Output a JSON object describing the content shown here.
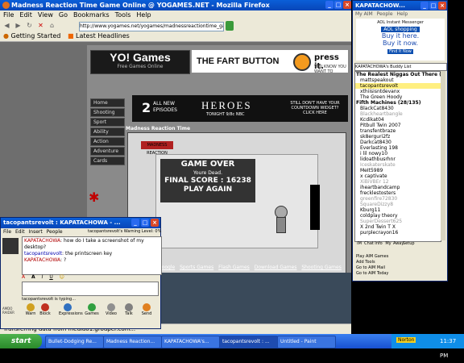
{
  "firefox": {
    "title": "Madness Reaction Time Game Online @ YOGAMES.NET - Mozilla Firefox",
    "menu": [
      "File",
      "Edit",
      "View",
      "Go",
      "Bookmarks",
      "Tools",
      "Help"
    ],
    "url": "http://www.yogames.net/yogames/madnessreactiontime_game.html",
    "bookmarks": [
      "Getting Started",
      "Latest Headlines"
    ],
    "status": "Transferring data from media01.grouper.com..."
  },
  "site": {
    "logo": "YO! Games",
    "logo_sub": "Free Games Online",
    "fart_ad": {
      "text": "THE FART BUTTON",
      "press": "press it.",
      "sub": "YOU KNOW YOU WANT TO"
    },
    "nav": [
      "Home",
      "Shooting",
      "Sport",
      "Ability",
      "Action",
      "Adventure",
      "Cards"
    ],
    "heroes_ad": {
      "number": "2",
      "line1": "ALL NEW",
      "line2": "EPISODES",
      "title": "HEROES",
      "tonight": "TONIGHT 9/8c NBC",
      "right": "STILL DON'T HAVE YOUR COUNTDOWN WIDGET? CLICK HERE"
    },
    "game_title": "Madness Reaction Time",
    "game": {
      "logo": "MADNESS REACTION",
      "over": "GAME OVER",
      "sub": "Youre Dead.",
      "score": "FINAL SCORE : 16238",
      "again": "PLAY AGAIN"
    },
    "google_links": [
      "Google",
      "Sports Games",
      "Flash Games",
      "Download Games",
      "Shooting Games"
    ]
  },
  "aim_buddylist": {
    "title": "KAPATACHOW...",
    "menu": [
      "My AIM",
      "People",
      "Help"
    ],
    "ad": {
      "brand": "AOL Instant Messenger",
      "shopping": "AOL shopping",
      "line1": "Buy it here.",
      "line2": "Buy it now.",
      "cta": "Find It Now"
    },
    "heading": "KAPATACHOWA's Buddy List",
    "rows": [
      {
        "text": "The Realest Niggas Out There (4/13)",
        "type": "group"
      },
      {
        "text": "mattspeakout",
        "type": "buddy"
      },
      {
        "text": "tacopantsrevolt",
        "type": "highlight"
      },
      {
        "text": "xthiisisntdevanx",
        "type": "buddy"
      },
      {
        "text": "The Green Hoody",
        "type": "buddy"
      },
      {
        "text": "Fifth Machines (28/135)",
        "type": "group"
      },
      {
        "text": "BlackCat8430",
        "type": "buddy"
      },
      {
        "text": "Blackheartbangle",
        "type": "idle"
      },
      {
        "text": "Kcdikat04",
        "type": "buddy"
      },
      {
        "text": "Pitbull Twin 2007",
        "type": "buddy"
      },
      {
        "text": "transfentbraze",
        "type": "buddy"
      },
      {
        "text": "sk8erguri2fz",
        "type": "buddy"
      },
      {
        "text": "Darkcat8430",
        "type": "buddy"
      },
      {
        "text": "Everlasting 198",
        "type": "buddy"
      },
      {
        "text": "i lil nowy10",
        "type": "buddy"
      },
      {
        "text": "lidoathbusrhnr",
        "type": "buddy"
      },
      {
        "text": "Iceskaterskate",
        "type": "idle"
      },
      {
        "text": "MeIt5989",
        "type": "buddy"
      },
      {
        "text": "x captivate",
        "type": "buddy"
      },
      {
        "text": "XiBiVBEr 12",
        "type": "idle"
      },
      {
        "text": "iheartbandcamp",
        "type": "buddy"
      },
      {
        "text": "frecklestosters",
        "type": "buddy"
      },
      {
        "text": "greenfire72830",
        "type": "idle"
      },
      {
        "text": "SquareDizzy8",
        "type": "idle"
      },
      {
        "text": "Kburg11",
        "type": "buddy"
      },
      {
        "text": "coldplay theory",
        "type": "buddy"
      },
      {
        "text": "SuperDessert625",
        "type": "idle"
      },
      {
        "text": "X 2nd Twin T X",
        "type": "buddy"
      },
      {
        "text": "purplecrayon16",
        "type": "buddy"
      }
    ],
    "toolbar": [
      "IM",
      "Chat",
      "Info",
      "My",
      "Away",
      "Setup"
    ],
    "links": [
      "Play AIM Games",
      "Add Tools",
      "Go to AIM Mail",
      "Go to AIM Today"
    ]
  },
  "im_window": {
    "title": "tacopantsrevolt : KAPATACHOWA - ...",
    "menu": [
      "File",
      "Edit",
      "Insert",
      "People"
    ],
    "warning": "tacopantsrevolt's Warning Level: 0%",
    "messages": [
      {
        "sender": "KAPATACHOWA",
        "text": "how do I take a screenshot of my desktop?"
      },
      {
        "sender": "tacopantsrevolt",
        "text": "the printscreen key"
      },
      {
        "sender": "KAPATACHOWA",
        "text": "?"
      }
    ],
    "typing": "tacopantsrevolt is typing...",
    "avatar_text": "AMDO RAIDER",
    "actions": [
      "Warn",
      "Block",
      "Expressions",
      "Games",
      "Video",
      "Talk",
      "Send"
    ]
  },
  "taskbar": {
    "start": "start",
    "buttons": [
      "Bullet-Dodging Re...",
      "Madness Reaction...",
      "KAPATACHOWA's...",
      "tacopantsrevolt : ...",
      "Untitled - Paint"
    ],
    "norton": "Norton",
    "clock": "11:37 PM"
  },
  "colors": {
    "xp_blue": "#0846b8",
    "taskbar_green": "#2a8a2a",
    "highlight_yellow": "#ffef80"
  }
}
